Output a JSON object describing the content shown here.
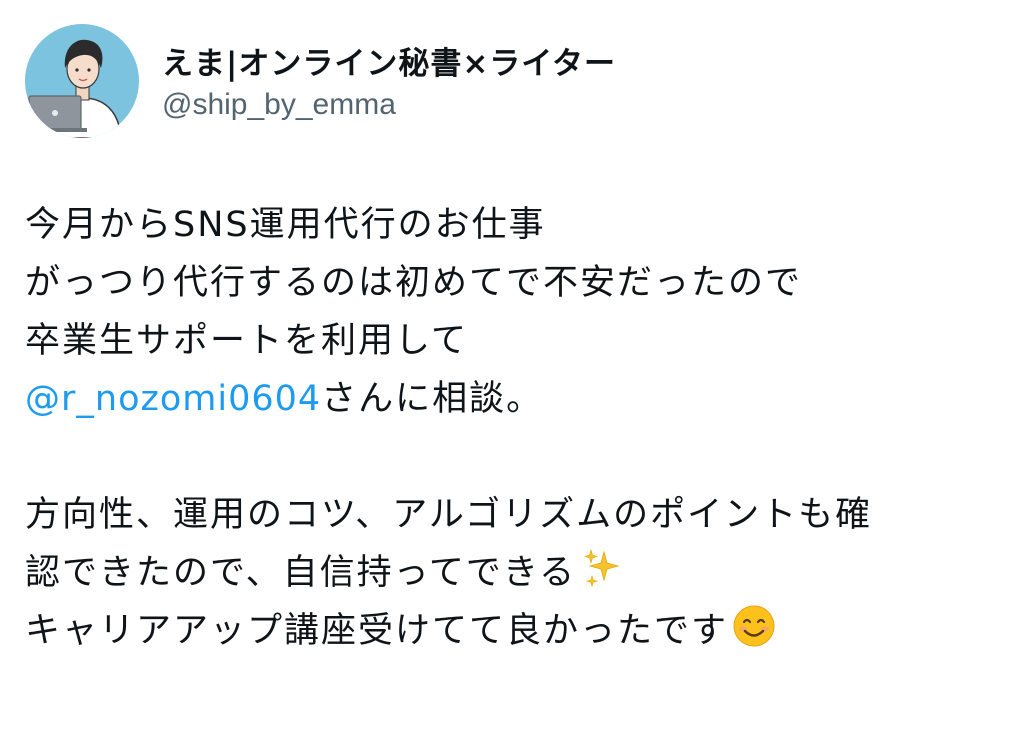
{
  "author": {
    "display_name": "えま|オンライン秘書×ライター",
    "handle": "@ship_by_emma",
    "avatar_icon": "person-with-laptop-avatar"
  },
  "tweet": {
    "line1": "今月からSNS運用代行のお仕事",
    "line2": "がっつり代行するのは初めてで不安だったので",
    "line3": "卒業生サポートを利用して",
    "mention": "@r_nozomi0604",
    "line4_rest": "さんに相談。",
    "line5": "方向性、運用のコツ、アルゴリズムのポイントも確",
    "line6": "認できたので、自信持ってできる",
    "line7": "キャリアアップ講座受けてて良かったです"
  },
  "emojis": {
    "sparkles": "sparkles-icon",
    "smile": "smiling-face-icon"
  },
  "colors": {
    "text": "#0f1419",
    "secondary": "#536471",
    "link": "#1d9bf0",
    "avatar_bg": "#7cc3e0"
  }
}
